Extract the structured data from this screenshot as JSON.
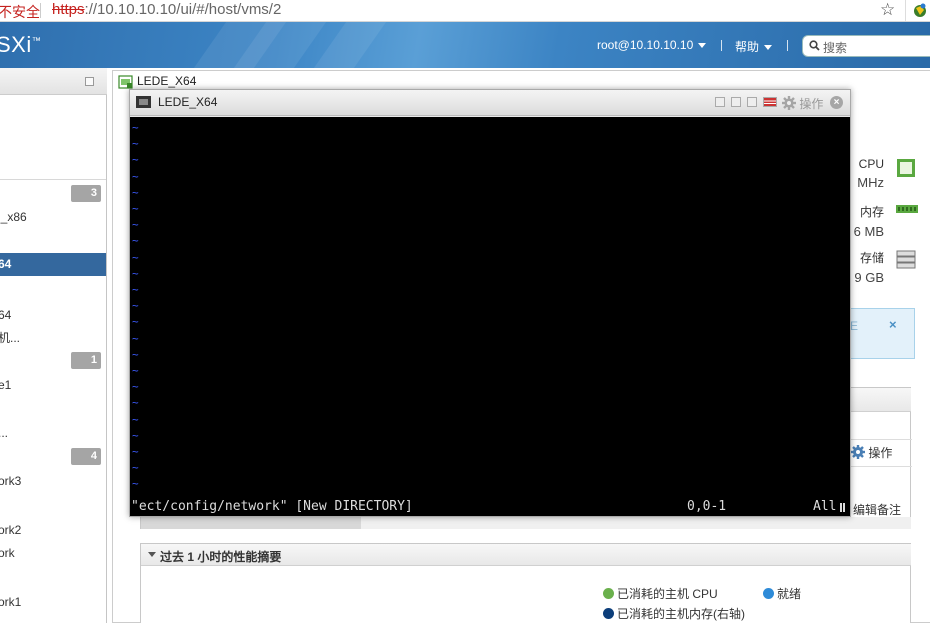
{
  "browser": {
    "security_label": "不安全",
    "url_scheme": "https",
    "url_rest": "://10.10.10.10/ui/#/host/vms/2"
  },
  "header": {
    "brand": "SXi",
    "brand_mark": "™",
    "user": "root@10.10.10.10",
    "help": "帮助",
    "search_placeholder": "搜索"
  },
  "nav": {
    "items": [
      {
        "label": "l_x86",
        "top": 0
      },
      {
        "label": "64"
      },
      {
        "label": "机..."
      },
      {
        "label": "e1"
      },
      {
        "label": "..."
      },
      {
        "label": "ork3"
      },
      {
        "label": "ork2"
      },
      {
        "label": "ork"
      },
      {
        "label": "ork1"
      }
    ],
    "selected": "64",
    "badges": [
      "3",
      "1",
      "4"
    ]
  },
  "vm": {
    "tab_title": "LEDE_X64",
    "console_title": "LEDE_X64",
    "console_actions": "操作",
    "close": "×"
  },
  "stats": {
    "cpu_label": "CPU",
    "cpu_value": "MHz",
    "mem_label": "内存",
    "mem_value": "6 MB",
    "storage_label": "存储",
    "storage_value": "9 GB"
  },
  "notice": {
    "partial_text": "E",
    "close": "×"
  },
  "panel1": {
    "actions_label": "操作",
    "note_label": "编辑备注"
  },
  "perf": {
    "title": "过去 1 小时的性能摘要",
    "legend": [
      {
        "label": "已消耗的主机 CPU",
        "color": "#6ab04c"
      },
      {
        "label": "就绪",
        "color": "#2e8bd8"
      },
      {
        "label": "已消耗的主机内存(右轴)",
        "color": "#0c3e7a"
      }
    ]
  },
  "terminal": {
    "tilde_char": "~",
    "status_file": "\"ect/config/network\" [New DIRECTORY]",
    "status_pos": "0,0-1",
    "status_all": "All"
  }
}
